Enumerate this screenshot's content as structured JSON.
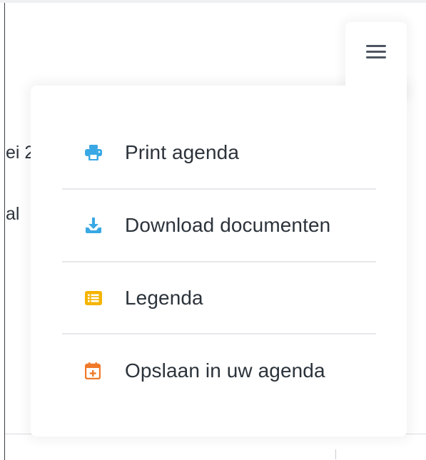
{
  "background": {
    "text_fragments": [
      "ei 2",
      "al"
    ]
  },
  "menu_toggle": {
    "icon": "hamburger-menu-icon"
  },
  "dropdown": {
    "items": [
      {
        "label": "Print agenda",
        "icon": "printer-icon",
        "color": "#3aa8e4"
      },
      {
        "label": "Download documenten",
        "icon": "download-icon",
        "color": "#3aa8e4"
      },
      {
        "label": "Legenda",
        "icon": "list-icon",
        "color": "#f5b400"
      },
      {
        "label": "Opslaan in uw agenda",
        "icon": "calendar-plus-icon",
        "color": "#ef7a2a"
      }
    ]
  },
  "colors": {
    "text": "#2c333b",
    "divider": "#e6e8ea",
    "hamburger": "#4d5660"
  }
}
